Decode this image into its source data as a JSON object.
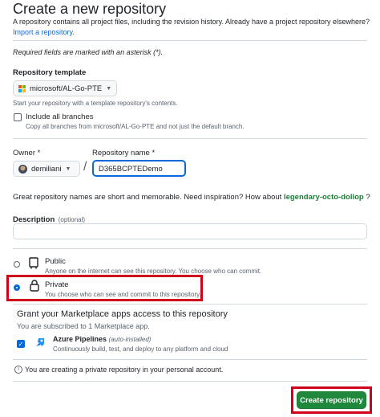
{
  "page": {
    "title": "Create a new repository",
    "intro": "A repository contains all project files, including the revision history. Already have a project repository elsewhere?",
    "import_link": "Import a repository.",
    "required_note": "Required fields are marked with an asterisk (*)."
  },
  "template": {
    "label": "Repository template",
    "selected": "microsoft/AL-Go-PTE",
    "help": "Start your repository with a template repository's contents.",
    "include_branches_label": "Include all branches",
    "include_branches_help": "Copy all branches from microsoft/AL-Go-PTE and not just the default branch.",
    "include_branches_checked": false
  },
  "owner": {
    "label": "Owner *",
    "value": "demiliani"
  },
  "repo_name": {
    "label": "Repository name *",
    "value": "D365BCPTEDemo",
    "separator": "/"
  },
  "suggestion": {
    "text": "Great repository names are short and memorable. Need inspiration? How about",
    "name": "legendary-octo-dollop",
    "end": "?"
  },
  "description": {
    "label": "Description",
    "optional": "(optional)",
    "value": ""
  },
  "visibility": {
    "public_label": "Public",
    "public_help": "Anyone on the internet can see this repository. You choose who can commit.",
    "private_label": "Private",
    "private_help": "You choose who can see and commit to this repository.",
    "selected": "private"
  },
  "marketplace": {
    "heading": "Grant your Marketplace apps access to this repository",
    "subscribed": "You are subscribed to 1 Marketplace app.",
    "app_name": "Azure Pipelines",
    "app_tag": "(auto-installed)",
    "app_desc": "Continuously build, test, and deploy to any platform and cloud",
    "app_checked": true
  },
  "notice": {
    "text": "You are creating a private repository in your personal account."
  },
  "actions": {
    "create_label": "Create repository"
  },
  "colors": {
    "accent": "#0969da",
    "primary_button": "#1f883d",
    "highlight": "#d0021b",
    "suggestion": "#1a7f37"
  }
}
